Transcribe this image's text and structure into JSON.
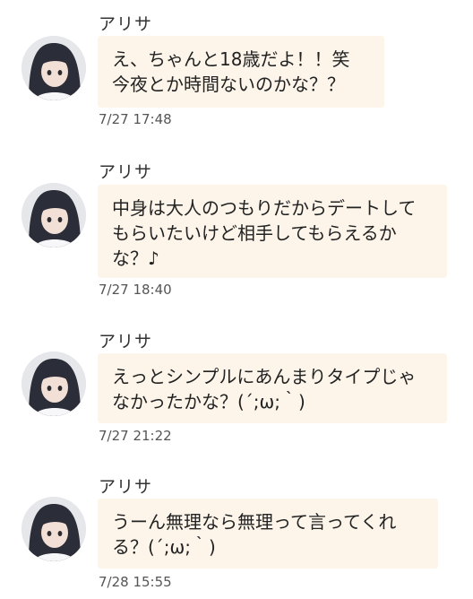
{
  "messages": [
    {
      "sender": "アリサ",
      "text": "え、ちゃんと18歳だよ！！笑\n今夜とか時間ないのかな？？",
      "time": "7/27 17:48"
    },
    {
      "sender": "アリサ",
      "text": "中身は大人のつもりだからデートして\nもらいたいけど相手してもらえるか\nな？♪",
      "time": "7/27 18:40"
    },
    {
      "sender": "アリサ",
      "text": "えっとシンプルにあんまりタイプじゃ\nなかったかな？(´;ω;｀)",
      "time": "7/27 21:22"
    },
    {
      "sender": "アリサ",
      "text": "うーん無理なら無理って言ってくれ\nる？(´;ω;｀)",
      "time": "7/28 15:55"
    }
  ],
  "colors": {
    "bubble": "#fdf5ea",
    "background": "#ffffff"
  }
}
